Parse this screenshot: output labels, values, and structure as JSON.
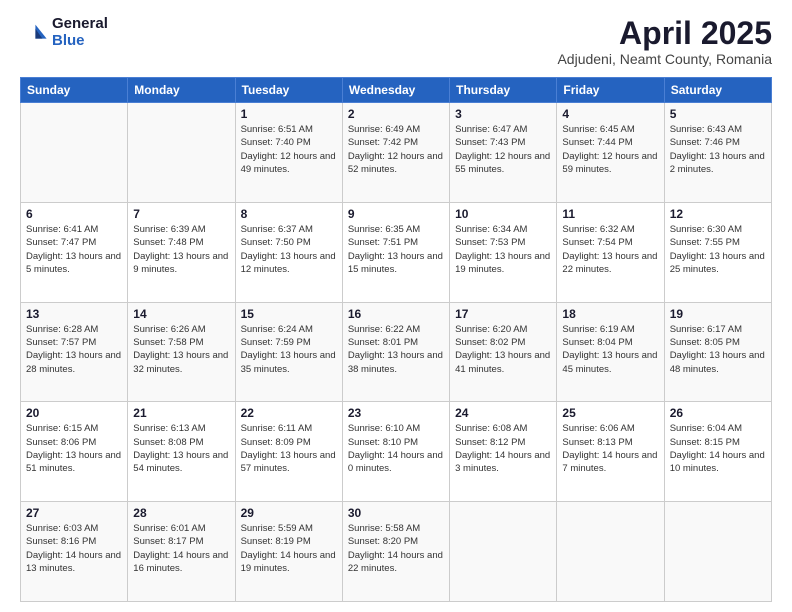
{
  "header": {
    "logo_general": "General",
    "logo_blue": "Blue",
    "month_title": "April 2025",
    "subtitle": "Adjudeni, Neamt County, Romania"
  },
  "days_of_week": [
    "Sunday",
    "Monday",
    "Tuesday",
    "Wednesday",
    "Thursday",
    "Friday",
    "Saturday"
  ],
  "weeks": [
    [
      {
        "day": "",
        "info": ""
      },
      {
        "day": "",
        "info": ""
      },
      {
        "day": "1",
        "info": "Sunrise: 6:51 AM\nSunset: 7:40 PM\nDaylight: 12 hours and 49 minutes."
      },
      {
        "day": "2",
        "info": "Sunrise: 6:49 AM\nSunset: 7:42 PM\nDaylight: 12 hours and 52 minutes."
      },
      {
        "day": "3",
        "info": "Sunrise: 6:47 AM\nSunset: 7:43 PM\nDaylight: 12 hours and 55 minutes."
      },
      {
        "day": "4",
        "info": "Sunrise: 6:45 AM\nSunset: 7:44 PM\nDaylight: 12 hours and 59 minutes."
      },
      {
        "day": "5",
        "info": "Sunrise: 6:43 AM\nSunset: 7:46 PM\nDaylight: 13 hours and 2 minutes."
      }
    ],
    [
      {
        "day": "6",
        "info": "Sunrise: 6:41 AM\nSunset: 7:47 PM\nDaylight: 13 hours and 5 minutes."
      },
      {
        "day": "7",
        "info": "Sunrise: 6:39 AM\nSunset: 7:48 PM\nDaylight: 13 hours and 9 minutes."
      },
      {
        "day": "8",
        "info": "Sunrise: 6:37 AM\nSunset: 7:50 PM\nDaylight: 13 hours and 12 minutes."
      },
      {
        "day": "9",
        "info": "Sunrise: 6:35 AM\nSunset: 7:51 PM\nDaylight: 13 hours and 15 minutes."
      },
      {
        "day": "10",
        "info": "Sunrise: 6:34 AM\nSunset: 7:53 PM\nDaylight: 13 hours and 19 minutes."
      },
      {
        "day": "11",
        "info": "Sunrise: 6:32 AM\nSunset: 7:54 PM\nDaylight: 13 hours and 22 minutes."
      },
      {
        "day": "12",
        "info": "Sunrise: 6:30 AM\nSunset: 7:55 PM\nDaylight: 13 hours and 25 minutes."
      }
    ],
    [
      {
        "day": "13",
        "info": "Sunrise: 6:28 AM\nSunset: 7:57 PM\nDaylight: 13 hours and 28 minutes."
      },
      {
        "day": "14",
        "info": "Sunrise: 6:26 AM\nSunset: 7:58 PM\nDaylight: 13 hours and 32 minutes."
      },
      {
        "day": "15",
        "info": "Sunrise: 6:24 AM\nSunset: 7:59 PM\nDaylight: 13 hours and 35 minutes."
      },
      {
        "day": "16",
        "info": "Sunrise: 6:22 AM\nSunset: 8:01 PM\nDaylight: 13 hours and 38 minutes."
      },
      {
        "day": "17",
        "info": "Sunrise: 6:20 AM\nSunset: 8:02 PM\nDaylight: 13 hours and 41 minutes."
      },
      {
        "day": "18",
        "info": "Sunrise: 6:19 AM\nSunset: 8:04 PM\nDaylight: 13 hours and 45 minutes."
      },
      {
        "day": "19",
        "info": "Sunrise: 6:17 AM\nSunset: 8:05 PM\nDaylight: 13 hours and 48 minutes."
      }
    ],
    [
      {
        "day": "20",
        "info": "Sunrise: 6:15 AM\nSunset: 8:06 PM\nDaylight: 13 hours and 51 minutes."
      },
      {
        "day": "21",
        "info": "Sunrise: 6:13 AM\nSunset: 8:08 PM\nDaylight: 13 hours and 54 minutes."
      },
      {
        "day": "22",
        "info": "Sunrise: 6:11 AM\nSunset: 8:09 PM\nDaylight: 13 hours and 57 minutes."
      },
      {
        "day": "23",
        "info": "Sunrise: 6:10 AM\nSunset: 8:10 PM\nDaylight: 14 hours and 0 minutes."
      },
      {
        "day": "24",
        "info": "Sunrise: 6:08 AM\nSunset: 8:12 PM\nDaylight: 14 hours and 3 minutes."
      },
      {
        "day": "25",
        "info": "Sunrise: 6:06 AM\nSunset: 8:13 PM\nDaylight: 14 hours and 7 minutes."
      },
      {
        "day": "26",
        "info": "Sunrise: 6:04 AM\nSunset: 8:15 PM\nDaylight: 14 hours and 10 minutes."
      }
    ],
    [
      {
        "day": "27",
        "info": "Sunrise: 6:03 AM\nSunset: 8:16 PM\nDaylight: 14 hours and 13 minutes."
      },
      {
        "day": "28",
        "info": "Sunrise: 6:01 AM\nSunset: 8:17 PM\nDaylight: 14 hours and 16 minutes."
      },
      {
        "day": "29",
        "info": "Sunrise: 5:59 AM\nSunset: 8:19 PM\nDaylight: 14 hours and 19 minutes."
      },
      {
        "day": "30",
        "info": "Sunrise: 5:58 AM\nSunset: 8:20 PM\nDaylight: 14 hours and 22 minutes."
      },
      {
        "day": "",
        "info": ""
      },
      {
        "day": "",
        "info": ""
      },
      {
        "day": "",
        "info": ""
      }
    ]
  ]
}
